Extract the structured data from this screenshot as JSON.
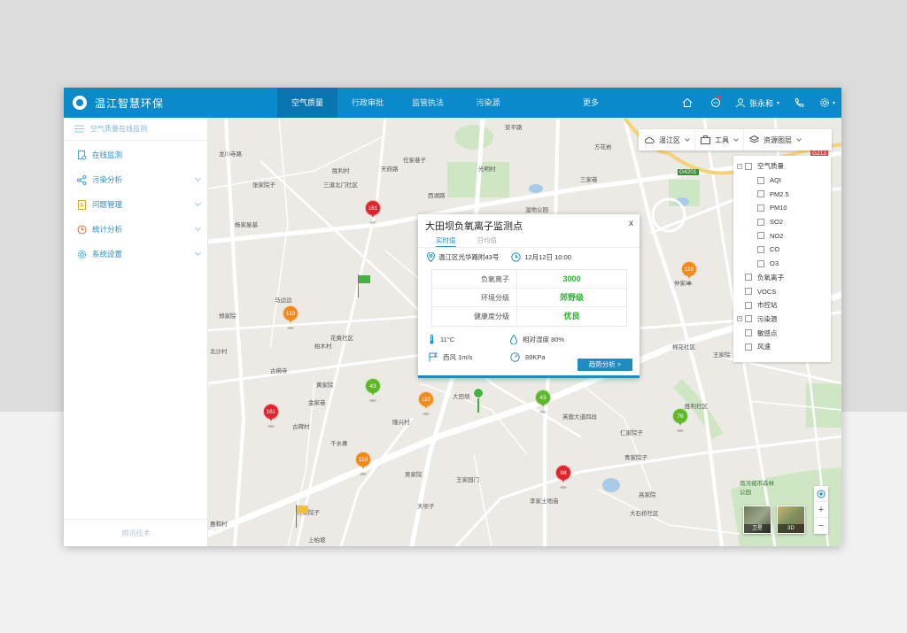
{
  "app": {
    "name": "温江智慧环保"
  },
  "nav": [
    {
      "label": "空气质量"
    },
    {
      "label": "行政审批"
    },
    {
      "label": "监管执法"
    },
    {
      "label": "污染源"
    },
    {
      "label": "更多"
    }
  ],
  "user": {
    "name": "张永和"
  },
  "sidebar": {
    "header": "空气质量在线监测",
    "items": [
      {
        "label": "在线监测"
      },
      {
        "label": "污染分析"
      },
      {
        "label": "问题管理"
      },
      {
        "label": "统计分析"
      },
      {
        "label": "系统设置"
      }
    ],
    "footer": "腾讯技术"
  },
  "toolbar": {
    "district": "温江区",
    "tools": "工具",
    "layers": "资源图层"
  },
  "layers": [
    "空气质量",
    "AQI",
    "PM2.5",
    "PM10",
    "SO2",
    "NO2",
    "CO",
    "O3",
    "负氧离子",
    "VOCS",
    "市控站",
    "污染源",
    "敏感点",
    "风速"
  ],
  "popup": {
    "title": "大田坝负氧离子监测点",
    "close": "x",
    "tabs": [
      "实时值",
      "日均值"
    ],
    "address": "温江区光华路附43号",
    "datetime": "12月12日  10:00",
    "rows": [
      {
        "label": "负氧离子",
        "value": "3000"
      },
      {
        "label": "环境分级",
        "value": "郊野级"
      },
      {
        "label": "健康度分级",
        "value": "优良"
      }
    ],
    "temp": "11°C",
    "humidity": "相对湿度  80%",
    "wind": "西风  1m/s",
    "pressure": "89KPa",
    "button": "趋势分析 >"
  },
  "markers": [
    {
      "value": "161",
      "color": "#e0242c"
    },
    {
      "value": "110",
      "color": "#f08a1c"
    },
    {
      "value": "43",
      "color": "#5fb82a"
    },
    {
      "value": "161",
      "color": "#e0242c"
    },
    {
      "value": "110",
      "color": "#f08a1c"
    },
    {
      "value": "110",
      "color": "#f08a1c"
    },
    {
      "value": "43",
      "color": "#5fb82a"
    },
    {
      "value": "88",
      "color": "#e0242c"
    },
    {
      "value": "110",
      "color": "#f08a1c"
    },
    {
      "value": "76",
      "color": "#5fb82a"
    }
  ],
  "map_labels": [
    "龙川寺路",
    "胜利村",
    "任家巷子",
    "光明村",
    "安平路",
    "天府路",
    "三道北门社区",
    "张家院子",
    "西湖路",
    "湿地公园",
    "杨家屋基",
    "马边边",
    "郑家院",
    "花黄社区",
    "柏木村",
    "古佛寺",
    "大田坝",
    "黄家院",
    "隆兴村",
    "金家巷",
    "千水寨",
    "古碑村",
    "王家园门",
    "吴家院",
    "天坝子",
    "李家土地庙",
    "芙蓉大道四段",
    "青家院子",
    "高家院",
    "大石桥社区",
    "南河城市森林公园",
    "王家院",
    "棉花社区",
    "仁家院子",
    "胜利社区",
    "三家巷",
    "方家院子",
    "仲家冲",
    "上柏坡",
    "惠和村",
    "方花岩",
    "北沙村",
    "卫星",
    "3D",
    "G4201",
    "G213"
  ],
  "maptypes": [
    "卫星",
    "3D"
  ],
  "zoom": {
    "in": "+",
    "out": "−"
  }
}
